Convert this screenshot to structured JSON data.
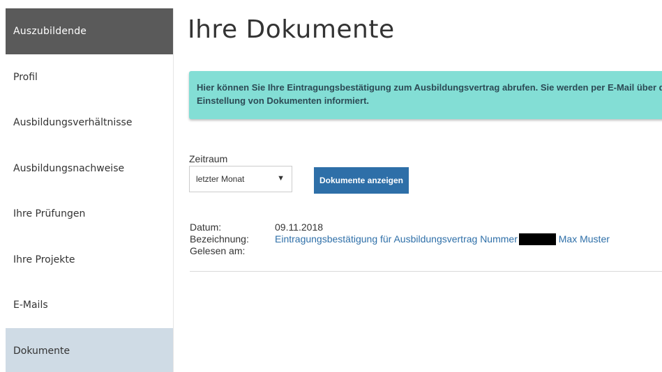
{
  "sidebar": {
    "header": "Auszubildende",
    "items": [
      {
        "label": "Profil"
      },
      {
        "label": "Ausbildungsverhältnisse"
      },
      {
        "label": "Ausbildungsnachweise"
      },
      {
        "label": "Ihre Prüfungen"
      },
      {
        "label": "Ihre Projekte"
      },
      {
        "label": "E-Mails"
      },
      {
        "label": "Dokumente",
        "active": true
      }
    ]
  },
  "main": {
    "title": "Ihre Dokumente",
    "info": "Hier können Sie Ihre Eintragungsbestätigung zum Ausbildungsvertrag abrufen. Sie werden per E-Mail über die Einstellung von Dokumenten informiert.",
    "filter": {
      "label": "Zeitraum",
      "selected": "letzter Monat",
      "button": "Dokumente anzeigen"
    },
    "document": {
      "date_label": "Datum:",
      "date_value": "09.11.2018",
      "name_label": "Bezeichnung:",
      "name_prefix": "Eintragungsbestätigung für Ausbildungsvertrag Nummer",
      "name_suffix": "Max Muster",
      "read_label": "Gelesen am:",
      "read_value": ""
    }
  },
  "colors": {
    "sidebar_header": "#5a5a5a",
    "sidebar_active": "#cfdbe5",
    "info_box": "#83ded5",
    "button": "#2e6fa8",
    "link": "#2e6fa8"
  },
  "icons": {
    "select_caret": "caret-down-icon"
  }
}
